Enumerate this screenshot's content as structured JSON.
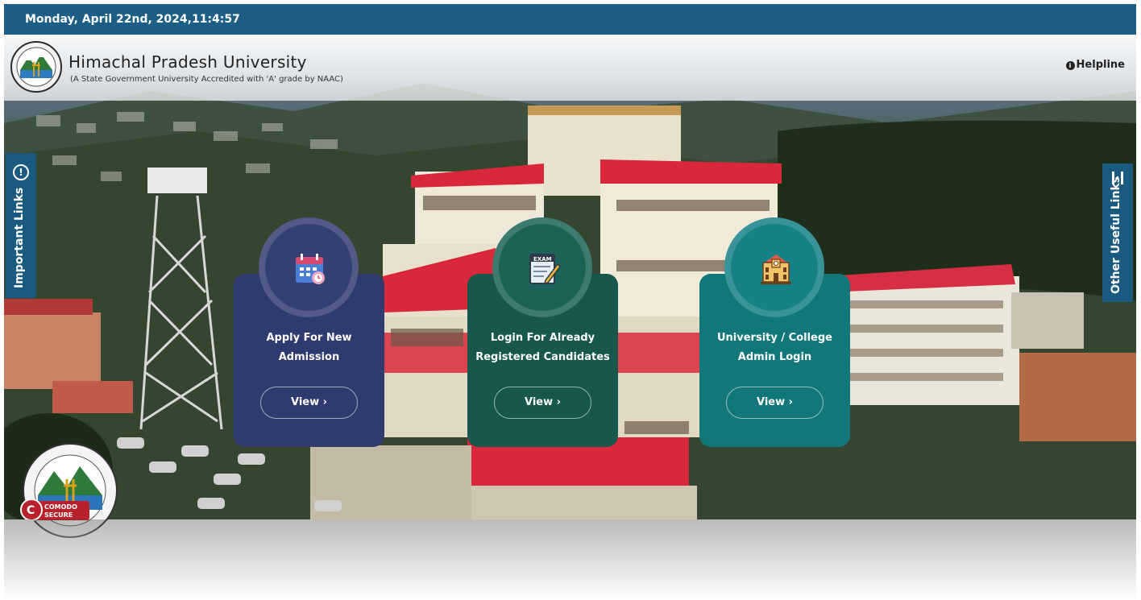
{
  "topbar": {
    "datetime": "Monday, April 22nd, 2024,11:4:57"
  },
  "header": {
    "title": "Himachal Pradesh University",
    "subtitle": "(A State Government University Accredited with 'A' grade by NAAC)",
    "helpline_label": "Helpline",
    "helpline_icon": "info-icon"
  },
  "side_tabs": {
    "left_label": "Important Links",
    "left_icon": "alert-circle-icon",
    "right_label": "Other Useful Links",
    "right_icon": "menu-icon"
  },
  "cards": [
    {
      "title_line1": "Apply For New",
      "title_line2": "Admission",
      "button": "View ›",
      "icon": "calendar-icon",
      "color": "#2f3a6e"
    },
    {
      "title_line1": "Login For Already",
      "title_line2": "Registered Candidates",
      "button": "View ›",
      "icon": "exam-icon",
      "color": "#17574d"
    },
    {
      "title_line1": "University / College",
      "title_line2": "Admin Login",
      "button": "View ›",
      "icon": "university-building-icon",
      "color": "#12777b"
    }
  ],
  "badge": {
    "line1": "COMODO",
    "line2": "SECURE"
  },
  "colors": {
    "topbar": "#1d5e86",
    "side_tab": "#1b5a80"
  }
}
